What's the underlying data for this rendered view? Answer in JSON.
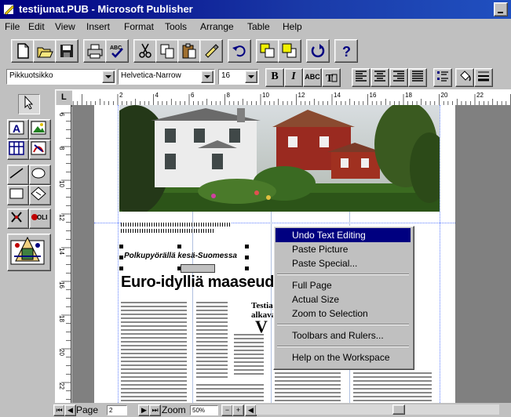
{
  "window": {
    "title": "testijunat.PUB - Microsoft Publisher"
  },
  "menu": [
    "File",
    "Edit",
    "View",
    "Insert",
    "Format",
    "Tools",
    "Arrange",
    "Table",
    "Help"
  ],
  "format_toolbar": {
    "style": "Pikkuotsikko",
    "font": "Helvetica-Narrow",
    "size": "16",
    "bold_label": "B",
    "italic_label": "I",
    "allcaps_label": "ABC"
  },
  "document": {
    "caption": "Polkupyörällä kesä-Suomessa",
    "headline": "Euro-idylliä maaseudulla",
    "sidebar_title": "Testiajot\nalkavat",
    "dropcap": "V"
  },
  "context_menu": [
    "Undo Text Editing",
    "Paste Picture",
    "Paste Special...",
    "Full Page",
    "Actual Size",
    "Zoom to Selection",
    "Toolbars and Rulers...",
    "Help on the Workspace"
  ],
  "statusbar": {
    "page_label": "Page",
    "page_value": "2",
    "zoom_label": "Zoom",
    "zoom_value": "50%"
  },
  "ruler": {
    "h_numbers": [
      "2",
      "4",
      "6",
      "8",
      "10",
      "12",
      "14",
      "16",
      "18",
      "20",
      "22"
    ],
    "v_numbers": [
      "6",
      "8",
      "10",
      "12",
      "14",
      "16",
      "18",
      "20",
      "22"
    ]
  },
  "colors": {
    "titlebar": "#000080",
    "selection": "#000080",
    "chrome": "#c0c0c0",
    "workspace": "#808080"
  }
}
